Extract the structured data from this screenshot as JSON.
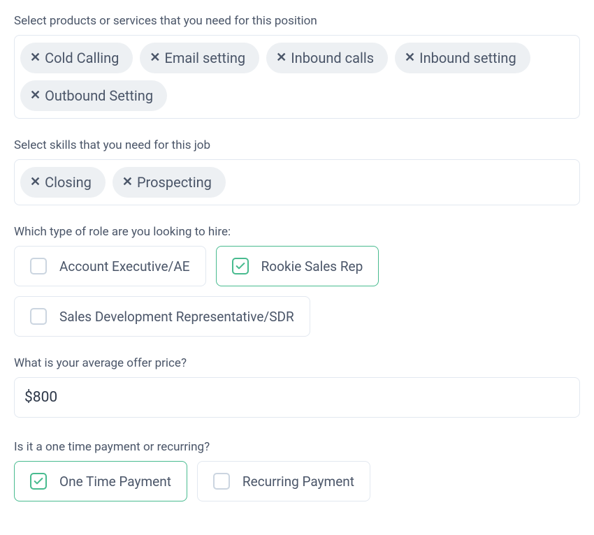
{
  "products": {
    "label": "Select products or services that you need for this position",
    "chips": [
      {
        "label": "Cold Calling"
      },
      {
        "label": "Email setting"
      },
      {
        "label": "Inbound calls"
      },
      {
        "label": "Inbound setting"
      },
      {
        "label": "Outbound Setting"
      }
    ]
  },
  "skills": {
    "label": "Select skills that you need for this job",
    "chips": [
      {
        "label": "Closing"
      },
      {
        "label": "Prospecting"
      }
    ]
  },
  "role": {
    "label": "Which type of role are you looking to hire:",
    "options": [
      {
        "label": "Account Executive/AE",
        "selected": false
      },
      {
        "label": "Rookie Sales Rep",
        "selected": true
      },
      {
        "label": "Sales Development Representative/SDR",
        "selected": false
      }
    ]
  },
  "offer": {
    "label": "What is your average offer price?",
    "value": "$800"
  },
  "payment": {
    "label": "Is it a one time payment or recurring?",
    "options": [
      {
        "label": "One Time Payment",
        "selected": true
      },
      {
        "label": "Recurring Payment",
        "selected": false
      }
    ]
  }
}
